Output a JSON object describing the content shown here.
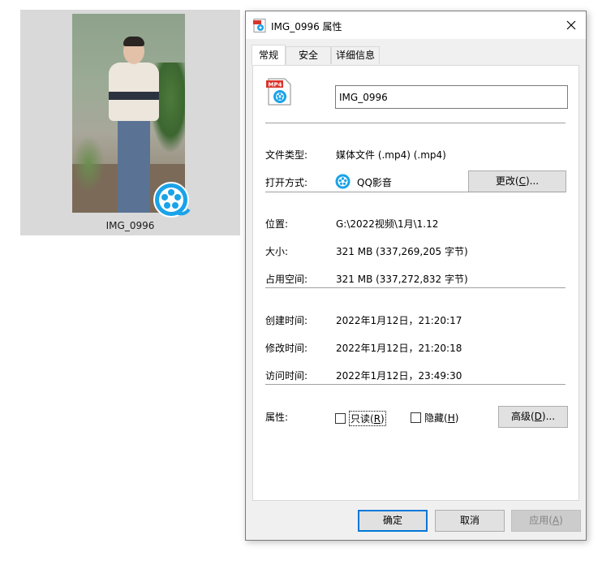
{
  "file_tile": {
    "name": "IMG_0996"
  },
  "dialog": {
    "title": "IMG_0996 属性",
    "tabs": [
      {
        "label": "常规",
        "active": true
      },
      {
        "label": "安全",
        "active": false
      },
      {
        "label": "详细信息",
        "active": false
      }
    ],
    "icon_badge": "MP4",
    "file_name_value": "IMG_0996",
    "file_type_label": "文件类型:",
    "file_type_value": "媒体文件 (.mp4) (.mp4)",
    "open_with_label": "打开方式:",
    "open_with_value": "QQ影音",
    "change_button": {
      "text": "更改(",
      "key": "C",
      "suffix": ")..."
    },
    "location_label": "位置:",
    "location_value": "G:\\2022视频\\1月\\1.12",
    "size_label": "大小:",
    "size_value": "321 MB (337,269,205 字节)",
    "size_on_disk_label": "占用空间:",
    "size_on_disk_value": "321 MB (337,272,832 字节)",
    "created_label": "创建时间:",
    "created_value": "2022年1月12日，21:20:17",
    "modified_label": "修改时间:",
    "modified_value": "2022年1月12日，21:20:18",
    "accessed_label": "访问时间:",
    "accessed_value": "2022年1月12日，23:49:30",
    "attributes_label": "属性:",
    "readonly": {
      "text": "只读(",
      "key": "R",
      "suffix": ")",
      "checked": false
    },
    "hidden": {
      "text": "隐藏(",
      "key": "H",
      "suffix": ")",
      "checked": false
    },
    "advanced_button": {
      "text": "高级(",
      "key": "D",
      "suffix": ")..."
    },
    "ok_button": "确定",
    "cancel_button": "取消",
    "apply_button": {
      "text": "应用(",
      "key": "A",
      "suffix": ")"
    }
  },
  "colors": {
    "accent": "#0078d7",
    "qq_blue": "#1aa3e8",
    "mp4_red": "#d9342b",
    "dialog_bg": "#f0f0f0"
  },
  "icons": {
    "title_icon": "mp4-file-icon",
    "close_icon": "close-icon",
    "qq_player_icon": "qq-player-icon"
  }
}
